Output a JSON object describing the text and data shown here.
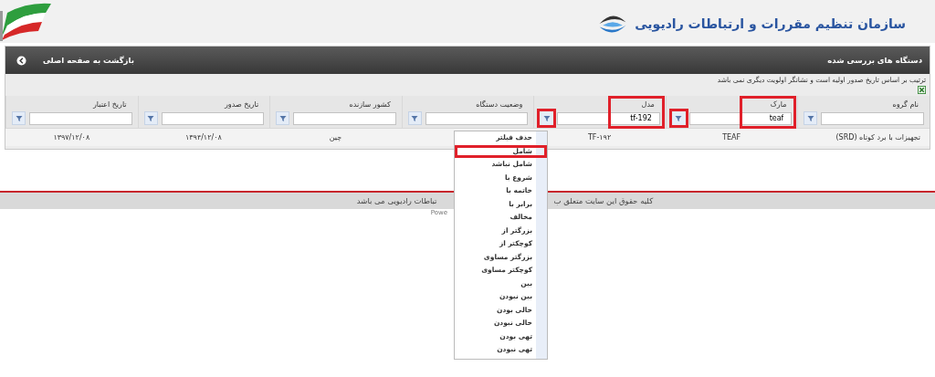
{
  "header": {
    "title": "سازمان تنظیم مقررات و ارتباطات رادیویی"
  },
  "panel": {
    "title": "دستگاه های بررسی شده",
    "back_link": "بازگشت به صفحه اصلی"
  },
  "notice": "ترتیب بر اساس تاریخ صدور اولیه است و نشانگر اولویت دیگری نمی باشد",
  "table": {
    "columns": [
      {
        "label": "نام گروه",
        "highlighted": false,
        "filter_button_highlighted": false
      },
      {
        "label": "مارک",
        "filter_value": "teaf",
        "highlighted": true,
        "filter_button_highlighted": true
      },
      {
        "label": "مدل",
        "filter_value": "tf-192",
        "highlighted": true,
        "filter_button_highlighted": true
      },
      {
        "label": "وضعیت دستگاه",
        "highlighted": false,
        "filter_button_highlighted": false
      },
      {
        "label": "کشور سازنده",
        "highlighted": false,
        "filter_button_highlighted": false
      },
      {
        "label": "تاریخ صدور",
        "highlighted": false,
        "filter_button_highlighted": false
      },
      {
        "label": "تاریخ اعتبار",
        "highlighted": false,
        "filter_button_highlighted": false
      }
    ],
    "rows": [
      [
        "تجهیزات با برد کوتاه (SRD)",
        "TEAF",
        "TF-۱۹۲",
        "",
        "چین",
        "۱۳۹۴/۱۲/۰۸",
        "۱۳۹۷/۱۲/۰۸"
      ]
    ]
  },
  "filter_menu": {
    "items": [
      {
        "label": "حذف فیلتر",
        "highlighted": false
      },
      {
        "label": "شامل",
        "highlighted": true
      },
      {
        "label": "شامل نباشد",
        "highlighted": false
      },
      {
        "label": "شروع با",
        "highlighted": false
      },
      {
        "label": "خاتمه با",
        "highlighted": false
      },
      {
        "label": "برابر با",
        "highlighted": false
      },
      {
        "label": "مخالف",
        "highlighted": false
      },
      {
        "label": "بزرگتر از",
        "highlighted": false
      },
      {
        "label": "کوچکتر از",
        "highlighted": false
      },
      {
        "label": "بزرگتر مساوی",
        "highlighted": false
      },
      {
        "label": "کوچکتر مساوی",
        "highlighted": false
      },
      {
        "label": "بین",
        "highlighted": false
      },
      {
        "label": "بین نبودن",
        "highlighted": false
      },
      {
        "label": "خالی بودن",
        "highlighted": false
      },
      {
        "label": "خالی نبودن",
        "highlighted": false
      },
      {
        "label": "تهی بودن",
        "highlighted": false
      },
      {
        "label": "تهی نبودن",
        "highlighted": false
      }
    ]
  },
  "footer": {
    "text_right": "کلیه حقوق این سایت متعلق ب",
    "text_left": "تباطات رادیویی می باشد",
    "credit": "Powe"
  }
}
